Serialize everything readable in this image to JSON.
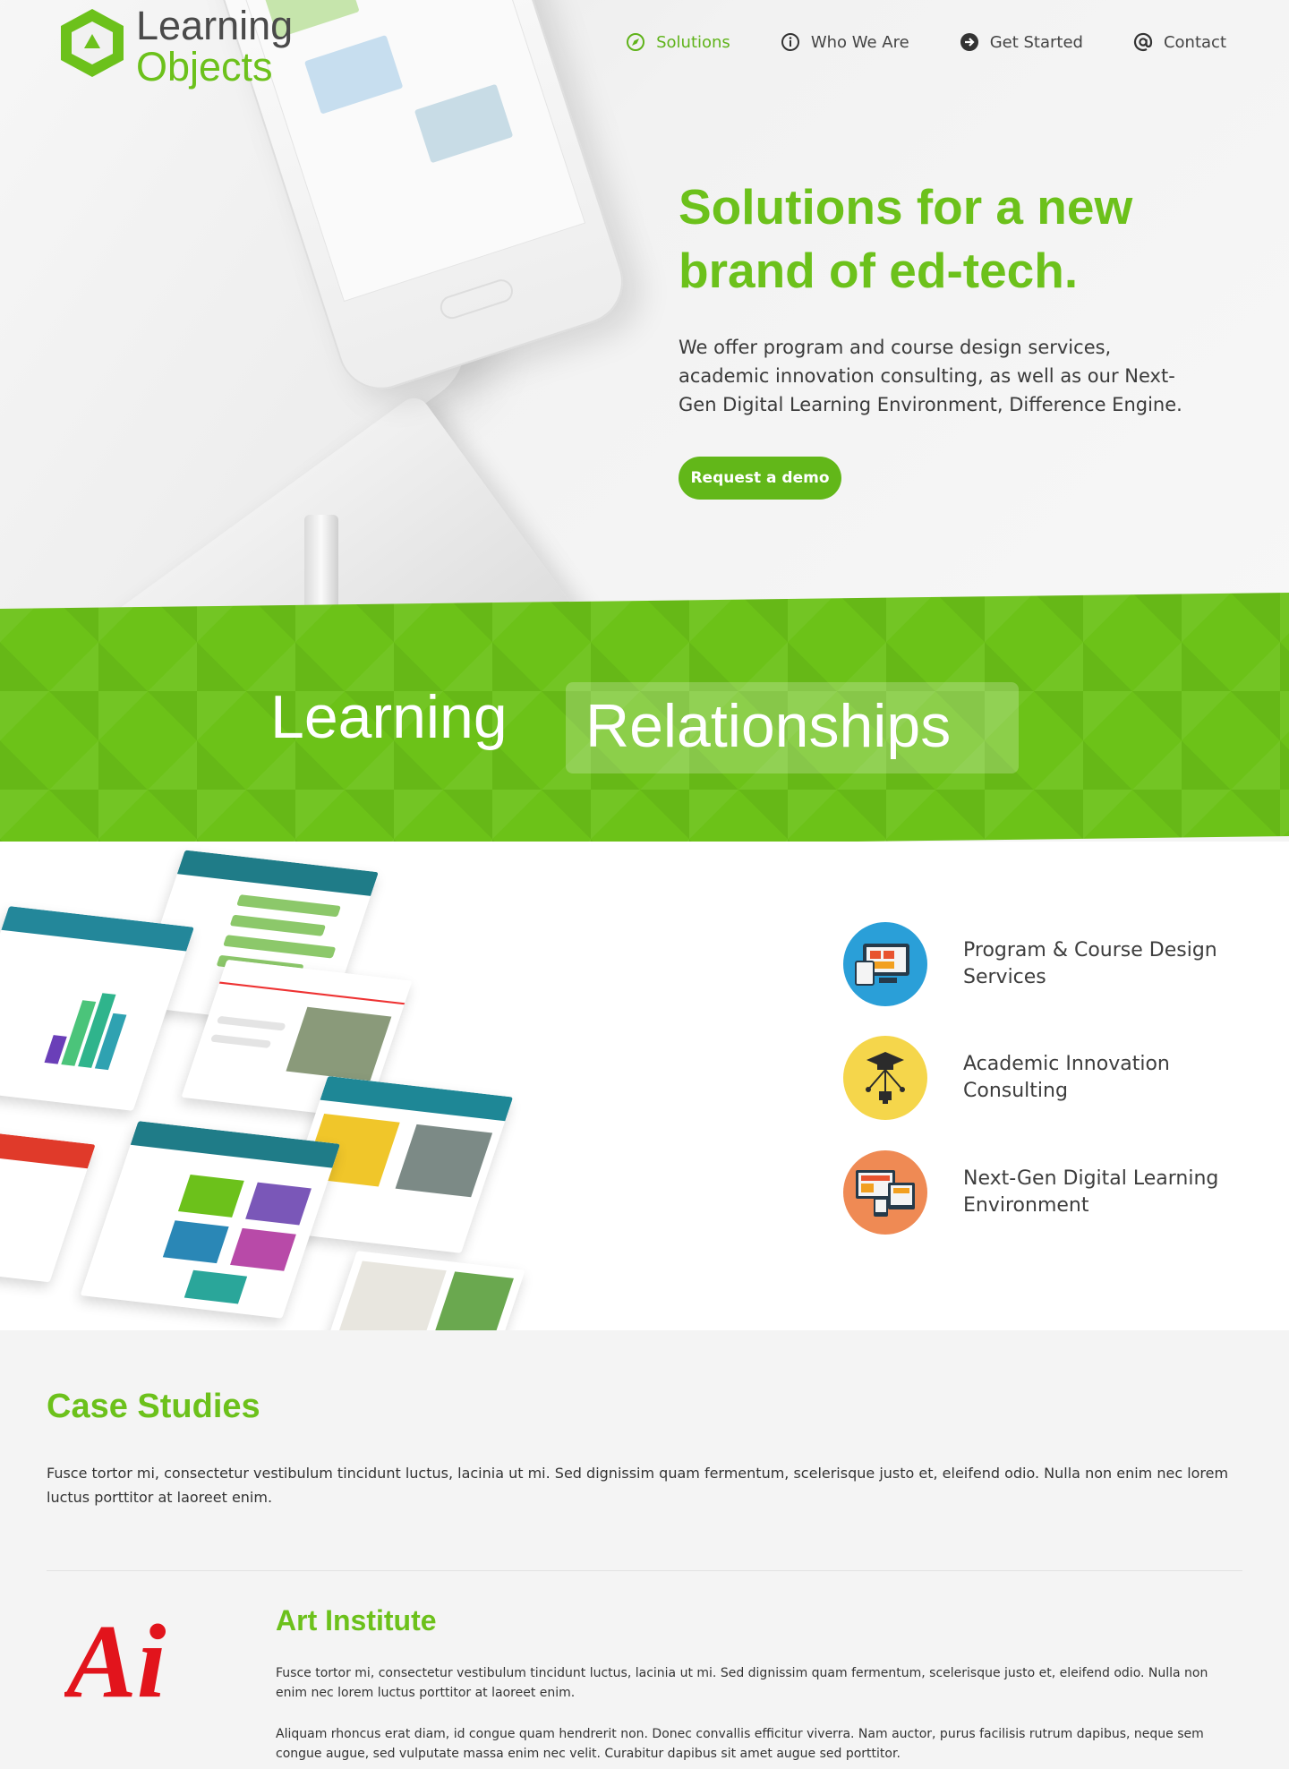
{
  "brand": {
    "line1": "Learning",
    "line2": "Objects"
  },
  "nav": [
    {
      "label": "Solutions",
      "icon": "compass-icon",
      "active": true
    },
    {
      "label": "Who We Are",
      "icon": "info-icon",
      "active": false
    },
    {
      "label": "Get Started",
      "icon": "arrow-right-circle-icon",
      "active": false
    },
    {
      "label": "Contact",
      "icon": "at-sign-icon",
      "active": false
    }
  ],
  "hero": {
    "title": "Solutions for a new brand of ed-tech.",
    "description": "We offer program and course design services, academic innovation consulting, as well as our Next-Gen Digital Learning Environment, Difference Engine.",
    "cta": "Request a demo"
  },
  "band": {
    "left": "Learning",
    "right": "Relationships"
  },
  "services": [
    {
      "label": "Program & Course Design Services",
      "icon": "devices-icon",
      "color": "#2a9fd8"
    },
    {
      "label": "Academic Innovation Consulting",
      "icon": "graduation-cap-icon",
      "color": "#f5d64b"
    },
    {
      "label": "Next-Gen Digital Learning Environment",
      "icon": "responsive-screens-icon",
      "color": "#ef8a54"
    }
  ],
  "cases": {
    "title": "Case Studies",
    "description": "Fusce tortor mi, consectetur vestibulum tincidunt luctus, lacinia ut mi. Sed dignissim quam fermentum, scelerisque justo et, eleifend odio. Nulla non enim nec lorem luctus porttitor at laoreet enim.",
    "items": [
      {
        "logo_text": "Ai",
        "name": "Art Institute",
        "p1": "Fusce tortor mi, consectetur vestibulum tincidunt luctus, lacinia ut mi. Sed dignissim quam fermentum, scelerisque justo et, eleifend odio. Nulla non enim nec lorem luctus porttitor at laoreet enim.",
        "p2": "Aliquam rhoncus erat diam, id congue quam hendrerit non. Donec convallis efficitur viverra. Nam auctor, purus facilisis rutrum dapibus, neque sem congue augue, sed vulputate massa enim nec velit. Curabitur dapibus sit amet augue sed porttitor."
      }
    ]
  },
  "colors": {
    "brand_green": "#6cc11b",
    "cta_green": "#62b719",
    "band_green": "#6cc218",
    "ai_red": "#e2141c"
  }
}
